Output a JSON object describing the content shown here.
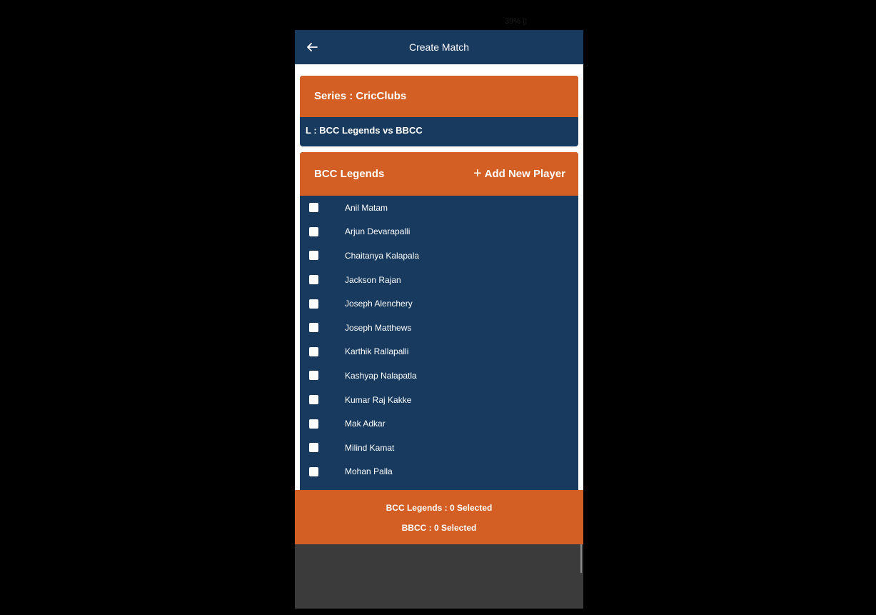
{
  "status_bar": {
    "battery_text": "39% ▯"
  },
  "app_bar": {
    "title": "Create Match",
    "back_icon": "arrow-left-icon"
  },
  "series_card": {
    "series_label": "Series : CricClubs",
    "match_label": "L : BCC Legends vs BBCC"
  },
  "team_card": {
    "team_name": "BCC Legends",
    "add_player_label": "Add New Player",
    "players": [
      "Anil Matam",
      "Arjun Devarapalli",
      "Chaitanya Kalapala",
      "Jackson Rajan",
      "Joseph Alenchery",
      "Joseph Matthews",
      "Karthik Rallapalli",
      "Kashyap Nalapatla",
      "Kumar Raj Kakke",
      "Mak Adkar",
      "Milind Kamat",
      "Mohan Palla"
    ]
  },
  "footer": {
    "team1_selected": "BCC Legends : 0 Selected",
    "team2_selected": "BBCC : 0 Selected"
  },
  "colors": {
    "navy": "#173a5e",
    "orange": "#d35f24",
    "background": "#000000"
  }
}
